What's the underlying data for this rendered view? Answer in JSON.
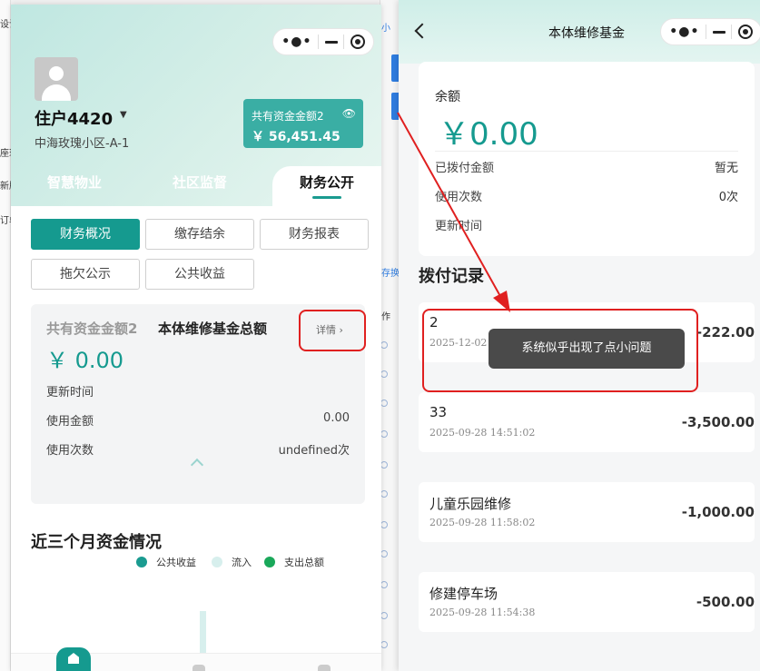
{
  "left_app": {
    "resident": {
      "name": "住户4420",
      "address": "中海玫瑰小区-A-1"
    },
    "fund_badge": {
      "label": "共有资金金额2",
      "value": "￥ 56,451.45"
    },
    "tabs": [
      {
        "label": "智慧物业"
      },
      {
        "label": "社区监督"
      },
      {
        "label": "财务公开"
      }
    ],
    "active_tab": "财务公开",
    "sub_tabs": [
      {
        "label": "财务概况"
      },
      {
        "label": "缴存结余"
      },
      {
        "label": "财务报表"
      },
      {
        "label": "拖欠公示"
      },
      {
        "label": "公共收益"
      }
    ],
    "active_sub_tab": "财务概况",
    "summary": {
      "label_gray": "共有资金金额2",
      "label_title": "本体维修基金总额",
      "detail_link": "详情",
      "amount": "￥ 0.00",
      "rows": [
        {
          "label": "更新时间",
          "value": ""
        },
        {
          "label": "使用金额",
          "value": "0.00"
        },
        {
          "label": "使用次数",
          "value": "undefined次"
        }
      ]
    },
    "trend": {
      "title": "近三个月资金情况",
      "legend": [
        {
          "name": "公共收益",
          "color": "#1a9b90"
        },
        {
          "name": "流入",
          "color": "#d7efed"
        },
        {
          "name": "支出总额",
          "color": "#1aa85a"
        }
      ]
    }
  },
  "right_app": {
    "title": "本体维修基金",
    "balance": {
      "label": "余额",
      "amount": "￥0.00",
      "rows": [
        {
          "label": "已拨付金额",
          "value": "暂无"
        },
        {
          "label": "使用次数",
          "value": "0次"
        },
        {
          "label": "更新时间",
          "value": ""
        }
      ]
    },
    "records_title": "拨付记录",
    "records": [
      {
        "name": "2",
        "time": "2025-12-02",
        "amount": "-222.00"
      },
      {
        "name": "33",
        "time": "2025-09-28 14:51:02",
        "amount": "-3,500.00"
      },
      {
        "name": "儿童乐园维修",
        "time": "2025-09-28 11:58:02",
        "amount": "-1,000.00"
      },
      {
        "name": "修建停车场",
        "time": "2025-09-28 11:54:38",
        "amount": "-500.00"
      }
    ],
    "toast": "系统似乎出现了点小问题"
  },
  "background": {
    "left_edge_items": [
      "设计",
      "座现",
      "新版",
      "订单"
    ],
    "mid_edge_items": [
      "小",
      "存换",
      "作"
    ]
  },
  "colors": {
    "accent": "#159a8f",
    "annotation_red": "#e02020",
    "toast_bg": "#4a4a4a"
  },
  "icons": [
    "more-dots-icon",
    "minimize-icon",
    "close-target-icon",
    "avatar-icon",
    "eye-icon",
    "caret-down-icon",
    "chevron-right-icon",
    "chevron-up-icon",
    "back-icon",
    "home-icon"
  ]
}
